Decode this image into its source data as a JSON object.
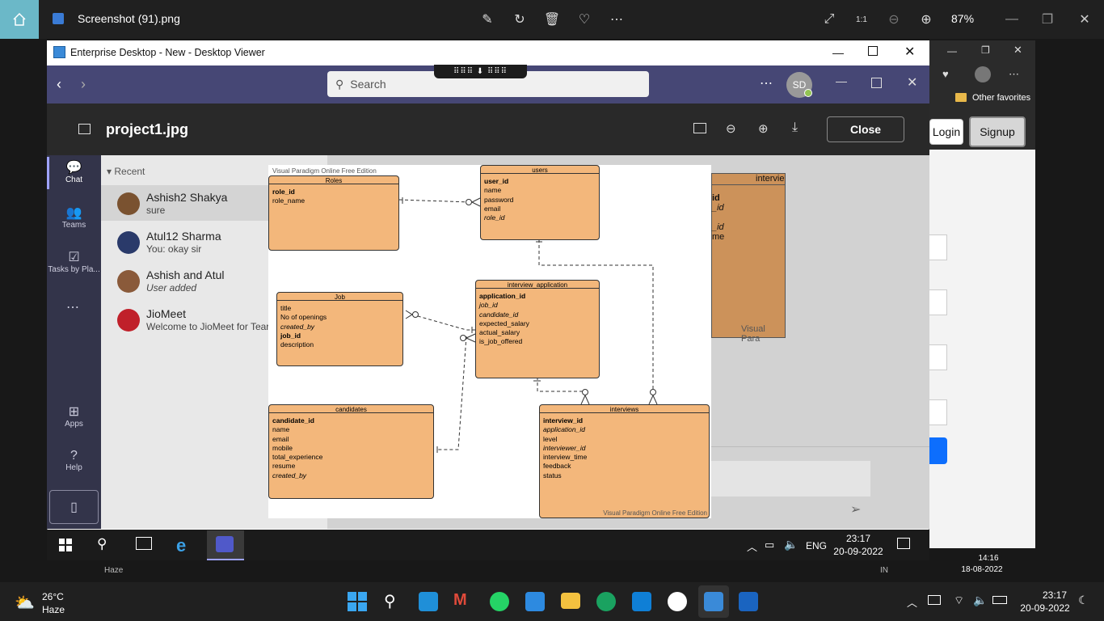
{
  "photos": {
    "title": "Screenshot (91).png",
    "zoom": "87%"
  },
  "remote": {
    "window_title": "Enterprise Desktop - New - Desktop Viewer"
  },
  "teams": {
    "search_placeholder": "Search",
    "avatar_initials": "SD",
    "file_name": "project1.jpg",
    "close_label": "Close",
    "rail": [
      {
        "label": "Chat"
      },
      {
        "label": "Teams"
      },
      {
        "label": "Tasks by Pla..."
      },
      {
        "label": "Apps"
      },
      {
        "label": "Help"
      }
    ],
    "recent_label": "Recent",
    "chats": [
      {
        "name": "Ashish2 Shakya",
        "message": "sure"
      },
      {
        "name": "Atul12 Sharma",
        "message": "You: okay sir"
      },
      {
        "name": "Ashish and Atul",
        "message": "User added"
      },
      {
        "name": "JioMeet",
        "message": "Welcome to JioMeet for Tear"
      }
    ]
  },
  "edge": {
    "favorites": "Other favorites",
    "login": "Login",
    "signup": "Signup"
  },
  "diagram": {
    "watermark_top": "Visual Paradigm Online Free Edition",
    "watermark_bottom": "Visual Paradigm Online Free Edition",
    "bg_entity_title": "intervie",
    "bg_watermark": "Visual Para",
    "roles": {
      "title": "Roles",
      "fields": [
        "role_id",
        "role_name"
      ]
    },
    "users": {
      "title": "users",
      "fields": [
        "user_id",
        "name",
        "password",
        "email",
        "role_id"
      ]
    },
    "job": {
      "title": "Job",
      "fields": [
        "title",
        "No of openings",
        "created_by",
        "job_id",
        "description"
      ]
    },
    "interview_application": {
      "title": "interview_application",
      "fields": [
        "application_id",
        "job_id",
        "candidate_id",
        "expected_salary",
        "actual_salary",
        "is_job_offered"
      ]
    },
    "candidates": {
      "title": "candidates",
      "fields": [
        "candidate_id",
        "name",
        "email",
        "mobile",
        "total_experience",
        "resume",
        "created_by"
      ]
    },
    "interviews": {
      "title": "interviews",
      "fields": [
        "interview_id",
        "application_id",
        "level",
        "interviewer_id",
        "interview_time",
        "feedback",
        "status"
      ]
    }
  },
  "remote_tray": {
    "lang": "ENG",
    "time": "23:17",
    "date": "20-09-2022"
  },
  "bg_tray": {
    "time": "14:16",
    "date": "18-08-2022",
    "lang": "IN",
    "weather": "Haze"
  },
  "win11": {
    "temperature": "26°C",
    "weather": "Haze",
    "time": "23:17",
    "date": "20-09-2022"
  }
}
